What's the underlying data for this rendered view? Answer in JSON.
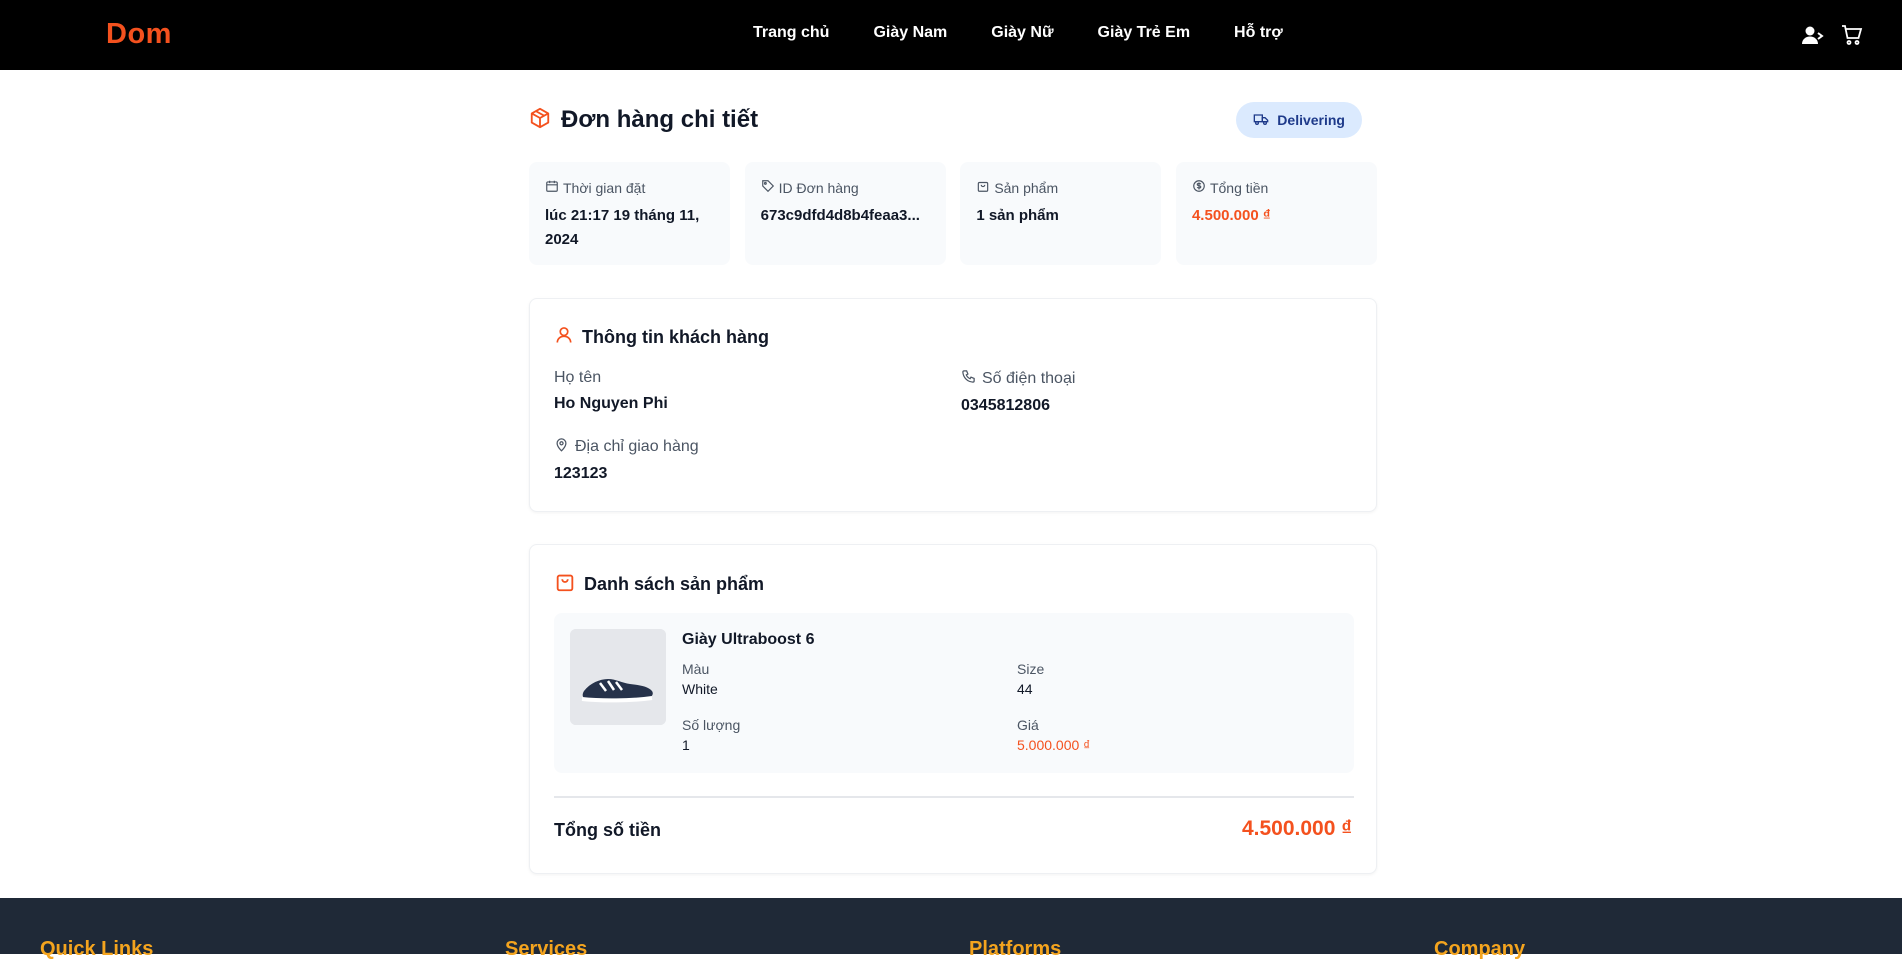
{
  "brand": {
    "logo": "Dom",
    "accent_color": "#f4511e"
  },
  "nav": {
    "links": [
      "Trang chủ",
      "Giày Nam",
      "Giày Nữ",
      "Giày Trẻ Em",
      "Hỗ trợ"
    ],
    "icons": [
      "user-icon",
      "cart-icon"
    ]
  },
  "order": {
    "title": "Đơn hàng chi tiết",
    "status": "Delivering",
    "stats": {
      "time_label": "Thời gian đặt",
      "time_value": "lúc 21:17 19 tháng 11, 2024",
      "id_label": "ID Đơn hàng",
      "id_value": "673c9dfd4d8b4feaa3...",
      "products_label": "Sản phẩm",
      "products_value": "1 sản phẩm",
      "total_label": "Tổng tiền",
      "total_value": "4.500.000 ₫"
    }
  },
  "customer": {
    "title": "Thông tin khách hàng",
    "name_label": "Họ tên",
    "name_value": "Ho Nguyen Phi",
    "phone_label": "Số điện thoại",
    "phone_value": "0345812806",
    "address_label": "Địa chỉ giao hàng",
    "address_value": "123123"
  },
  "products": {
    "title": "Danh sách sản phẩm",
    "items": [
      {
        "name": "Giày Ultraboost 6",
        "color_label": "Màu",
        "color_value": "White",
        "size_label": "Size",
        "size_value": "44",
        "qty_label": "Số lượng",
        "qty_value": "1",
        "price_label": "Giá",
        "price_value": "5.000.000 ₫"
      }
    ],
    "total_label": "Tổng số tiền",
    "total_value": "4.500.000 ₫"
  },
  "footer": {
    "columns": [
      "Quick Links",
      "Services",
      "Platforms",
      "Company"
    ]
  }
}
